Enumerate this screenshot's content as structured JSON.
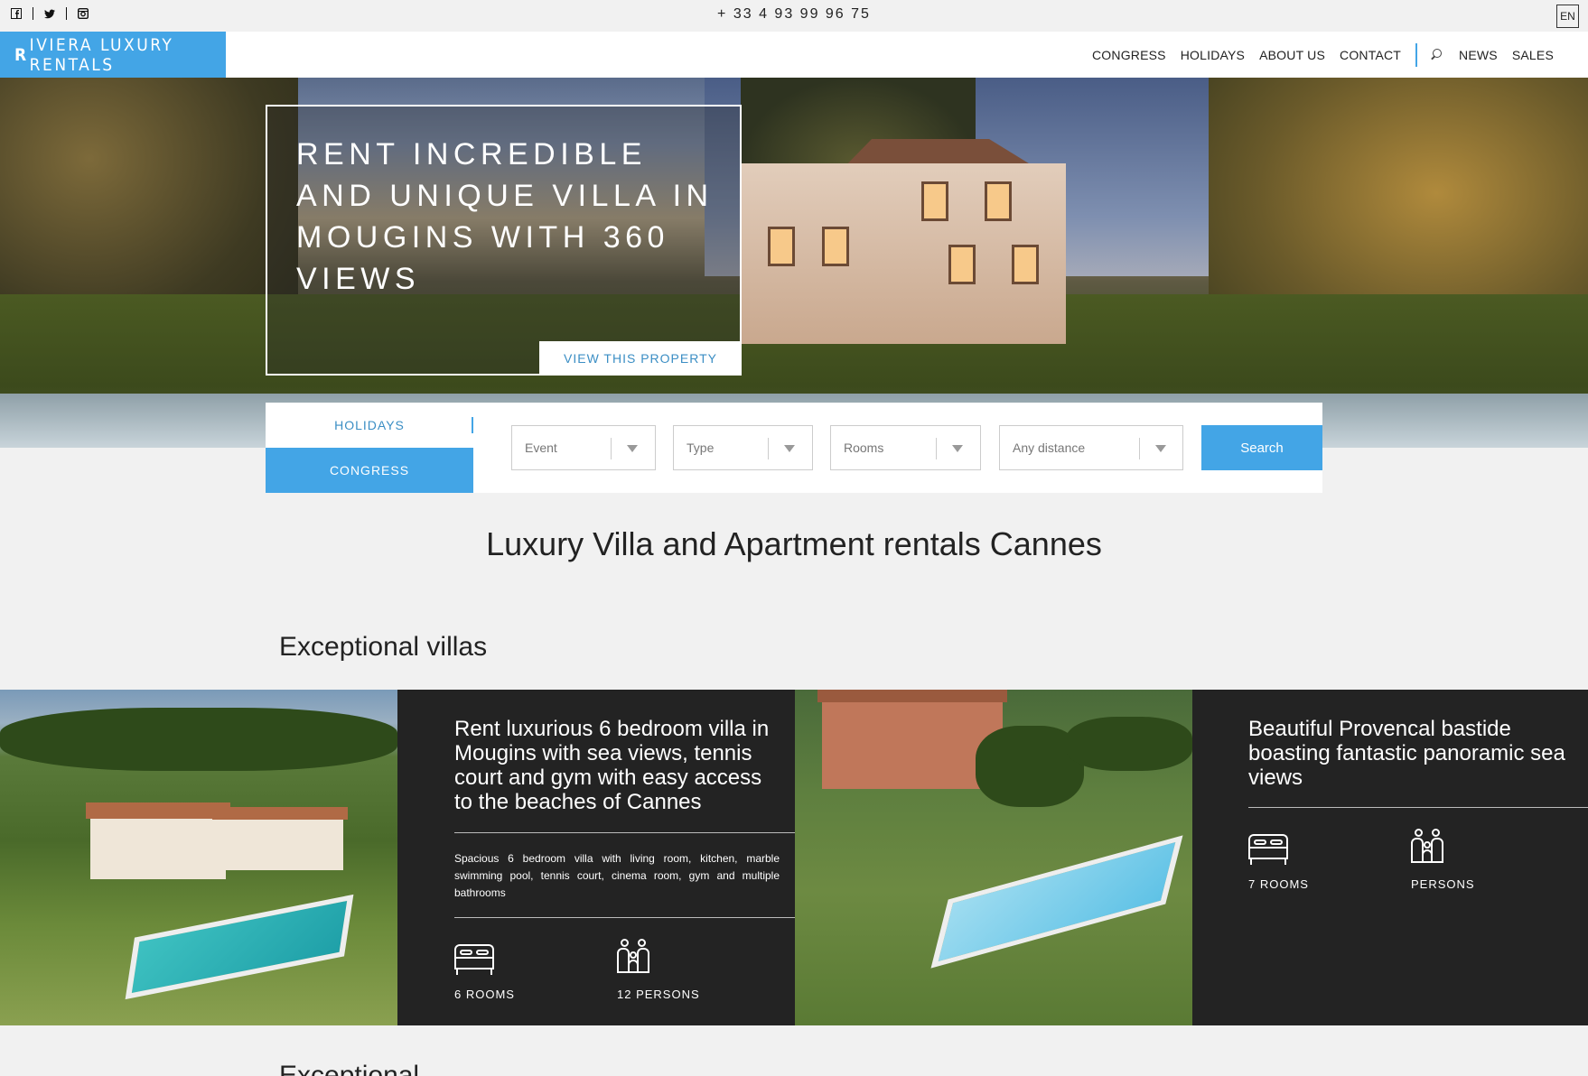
{
  "topbar": {
    "social": [
      "facebook-icon",
      "twitter-icon",
      "instagram-icon"
    ],
    "phone": "+ 33 4 93 99 96 75",
    "lang": "EN"
  },
  "nav": {
    "logo": "IVIERA LUXURY RENTALS",
    "logo_mark": "R",
    "items": [
      "CONGRESS",
      "HOLIDAYS",
      "ABOUT US",
      "CONTACT"
    ],
    "items_right": [
      "NEWS",
      "SALES"
    ]
  },
  "hero": {
    "title": "RENT INCREDIBLE AND UNIQUE VILLA IN MOUGINS WITH 360 VIEWS",
    "button": "VIEW THIS PROPERTY"
  },
  "search": {
    "tab_holidays": "HOLIDAYS",
    "tab_congress": "CONGRESS",
    "event": "Event",
    "type": "Type",
    "rooms": "Rooms",
    "distance": "Any distance",
    "button": "Search"
  },
  "page_title": "Luxury Villa and Apartment rentals Cannes",
  "section_title": "Exceptional villas",
  "villas": [
    {
      "title": "Rent luxurious 6 bedroom villa in Mougins with sea views, tennis court and gym with easy access to the beaches of Cannes",
      "description": "Spacious 6 bedroom villa with living room, kitchen, marble swimming pool, tennis court, cinema room, gym and multiple bathrooms",
      "rooms": "6 ROOMS",
      "persons": "12 PERSONS"
    },
    {
      "title": "Beautiful Provencal bastide boasting fantastic panoramic sea views",
      "rooms": "7 ROOMS",
      "persons": "PERSONS"
    }
  ],
  "next_section": "Exceptional"
}
